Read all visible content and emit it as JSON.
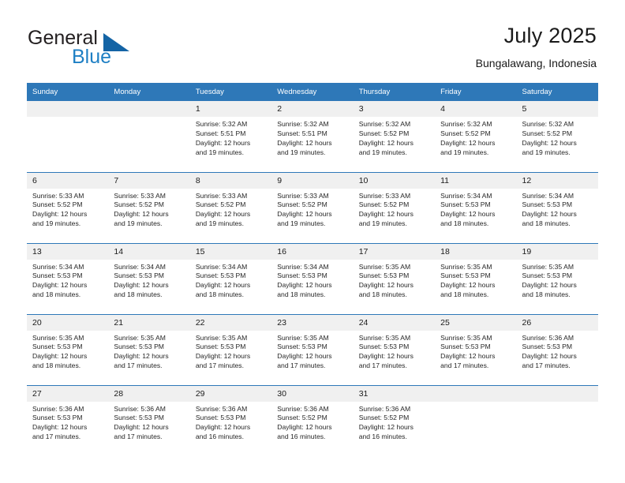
{
  "brand": {
    "name_part1": "General",
    "name_part2": "Blue",
    "flag_color": "#1464a5"
  },
  "header": {
    "title": "July 2025",
    "subtitle": "Bungalawang, Indonesia"
  },
  "theme": {
    "header_blue": "#2e78b8",
    "daynum_gray": "#f0f0f0",
    "text": "#1a1a1a"
  },
  "calendar": {
    "weekday_headers": [
      "Sunday",
      "Monday",
      "Tuesday",
      "Wednesday",
      "Thursday",
      "Friday",
      "Saturday"
    ],
    "weeks": [
      [
        {
          "day": "",
          "lines": []
        },
        {
          "day": "",
          "lines": []
        },
        {
          "day": "1",
          "lines": [
            "Sunrise: 5:32 AM",
            "Sunset: 5:51 PM",
            "Daylight: 12 hours",
            "and 19 minutes."
          ]
        },
        {
          "day": "2",
          "lines": [
            "Sunrise: 5:32 AM",
            "Sunset: 5:51 PM",
            "Daylight: 12 hours",
            "and 19 minutes."
          ]
        },
        {
          "day": "3",
          "lines": [
            "Sunrise: 5:32 AM",
            "Sunset: 5:52 PM",
            "Daylight: 12 hours",
            "and 19 minutes."
          ]
        },
        {
          "day": "4",
          "lines": [
            "Sunrise: 5:32 AM",
            "Sunset: 5:52 PM",
            "Daylight: 12 hours",
            "and 19 minutes."
          ]
        },
        {
          "day": "5",
          "lines": [
            "Sunrise: 5:32 AM",
            "Sunset: 5:52 PM",
            "Daylight: 12 hours",
            "and 19 minutes."
          ]
        }
      ],
      [
        {
          "day": "6",
          "lines": [
            "Sunrise: 5:33 AM",
            "Sunset: 5:52 PM",
            "Daylight: 12 hours",
            "and 19 minutes."
          ]
        },
        {
          "day": "7",
          "lines": [
            "Sunrise: 5:33 AM",
            "Sunset: 5:52 PM",
            "Daylight: 12 hours",
            "and 19 minutes."
          ]
        },
        {
          "day": "8",
          "lines": [
            "Sunrise: 5:33 AM",
            "Sunset: 5:52 PM",
            "Daylight: 12 hours",
            "and 19 minutes."
          ]
        },
        {
          "day": "9",
          "lines": [
            "Sunrise: 5:33 AM",
            "Sunset: 5:52 PM",
            "Daylight: 12 hours",
            "and 19 minutes."
          ]
        },
        {
          "day": "10",
          "lines": [
            "Sunrise: 5:33 AM",
            "Sunset: 5:52 PM",
            "Daylight: 12 hours",
            "and 19 minutes."
          ]
        },
        {
          "day": "11",
          "lines": [
            "Sunrise: 5:34 AM",
            "Sunset: 5:53 PM",
            "Daylight: 12 hours",
            "and 18 minutes."
          ]
        },
        {
          "day": "12",
          "lines": [
            "Sunrise: 5:34 AM",
            "Sunset: 5:53 PM",
            "Daylight: 12 hours",
            "and 18 minutes."
          ]
        }
      ],
      [
        {
          "day": "13",
          "lines": [
            "Sunrise: 5:34 AM",
            "Sunset: 5:53 PM",
            "Daylight: 12 hours",
            "and 18 minutes."
          ]
        },
        {
          "day": "14",
          "lines": [
            "Sunrise: 5:34 AM",
            "Sunset: 5:53 PM",
            "Daylight: 12 hours",
            "and 18 minutes."
          ]
        },
        {
          "day": "15",
          "lines": [
            "Sunrise: 5:34 AM",
            "Sunset: 5:53 PM",
            "Daylight: 12 hours",
            "and 18 minutes."
          ]
        },
        {
          "day": "16",
          "lines": [
            "Sunrise: 5:34 AM",
            "Sunset: 5:53 PM",
            "Daylight: 12 hours",
            "and 18 minutes."
          ]
        },
        {
          "day": "17",
          "lines": [
            "Sunrise: 5:35 AM",
            "Sunset: 5:53 PM",
            "Daylight: 12 hours",
            "and 18 minutes."
          ]
        },
        {
          "day": "18",
          "lines": [
            "Sunrise: 5:35 AM",
            "Sunset: 5:53 PM",
            "Daylight: 12 hours",
            "and 18 minutes."
          ]
        },
        {
          "day": "19",
          "lines": [
            "Sunrise: 5:35 AM",
            "Sunset: 5:53 PM",
            "Daylight: 12 hours",
            "and 18 minutes."
          ]
        }
      ],
      [
        {
          "day": "20",
          "lines": [
            "Sunrise: 5:35 AM",
            "Sunset: 5:53 PM",
            "Daylight: 12 hours",
            "and 18 minutes."
          ]
        },
        {
          "day": "21",
          "lines": [
            "Sunrise: 5:35 AM",
            "Sunset: 5:53 PM",
            "Daylight: 12 hours",
            "and 17 minutes."
          ]
        },
        {
          "day": "22",
          "lines": [
            "Sunrise: 5:35 AM",
            "Sunset: 5:53 PM",
            "Daylight: 12 hours",
            "and 17 minutes."
          ]
        },
        {
          "day": "23",
          "lines": [
            "Sunrise: 5:35 AM",
            "Sunset: 5:53 PM",
            "Daylight: 12 hours",
            "and 17 minutes."
          ]
        },
        {
          "day": "24",
          "lines": [
            "Sunrise: 5:35 AM",
            "Sunset: 5:53 PM",
            "Daylight: 12 hours",
            "and 17 minutes."
          ]
        },
        {
          "day": "25",
          "lines": [
            "Sunrise: 5:35 AM",
            "Sunset: 5:53 PM",
            "Daylight: 12 hours",
            "and 17 minutes."
          ]
        },
        {
          "day": "26",
          "lines": [
            "Sunrise: 5:36 AM",
            "Sunset: 5:53 PM",
            "Daylight: 12 hours",
            "and 17 minutes."
          ]
        }
      ],
      [
        {
          "day": "27",
          "lines": [
            "Sunrise: 5:36 AM",
            "Sunset: 5:53 PM",
            "Daylight: 12 hours",
            "and 17 minutes."
          ]
        },
        {
          "day": "28",
          "lines": [
            "Sunrise: 5:36 AM",
            "Sunset: 5:53 PM",
            "Daylight: 12 hours",
            "and 17 minutes."
          ]
        },
        {
          "day": "29",
          "lines": [
            "Sunrise: 5:36 AM",
            "Sunset: 5:53 PM",
            "Daylight: 12 hours",
            "and 16 minutes."
          ]
        },
        {
          "day": "30",
          "lines": [
            "Sunrise: 5:36 AM",
            "Sunset: 5:52 PM",
            "Daylight: 12 hours",
            "and 16 minutes."
          ]
        },
        {
          "day": "31",
          "lines": [
            "Sunrise: 5:36 AM",
            "Sunset: 5:52 PM",
            "Daylight: 12 hours",
            "and 16 minutes."
          ]
        },
        {
          "day": "",
          "lines": []
        },
        {
          "day": "",
          "lines": []
        }
      ]
    ]
  }
}
